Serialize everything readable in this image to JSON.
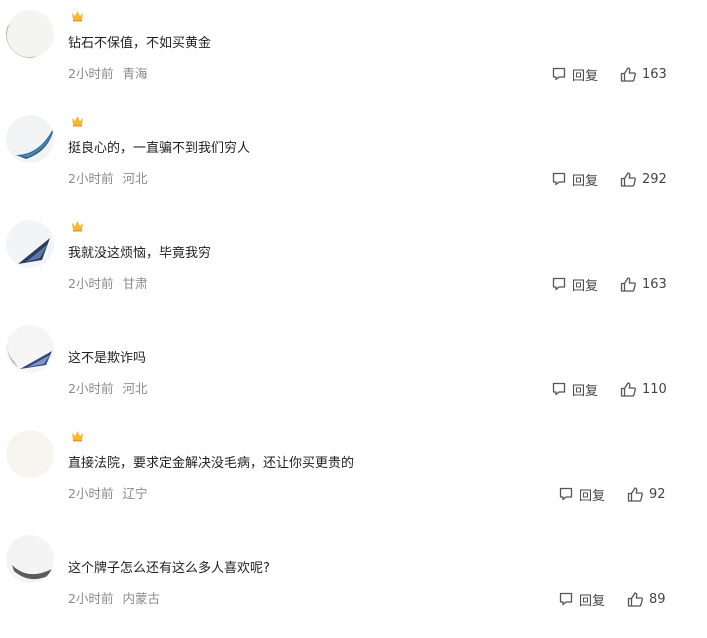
{
  "reply_label": "回复",
  "comments": [
    {
      "username": "",
      "content": "钻石不保值，不如买黄金",
      "time": "2小时前",
      "location": "青海",
      "likes": "163"
    },
    {
      "username": "",
      "content": "挺良心的，一直骗不到我们穷人",
      "time": "2小时前",
      "location": "河北",
      "likes": "292"
    },
    {
      "username": "",
      "content": "我就没这烦恼，毕竟我穷",
      "time": "2小时前",
      "location": "甘肃",
      "likes": "163"
    },
    {
      "username": "",
      "content": "这不是欺诈吗",
      "time": "2小时前",
      "location": "河北",
      "likes": "110"
    },
    {
      "username": "",
      "content": "直接法院，要求定金解决没毛病，还让你买更贵的",
      "time": "2小时前",
      "location": "辽宁",
      "likes": "92"
    },
    {
      "username": "",
      "content": "这个牌子怎么还有这么多人喜欢呢?",
      "time": "2小时前",
      "location": "内蒙古",
      "likes": "89"
    }
  ],
  "icons": {
    "reply": "comment-bubble-icon",
    "like": "thumbs-up-icon",
    "badge": "crown-badge-icon"
  },
  "colors": {
    "text": "#1f1f1f",
    "meta": "#8a8a8a",
    "badge": "#f5b63a"
  }
}
